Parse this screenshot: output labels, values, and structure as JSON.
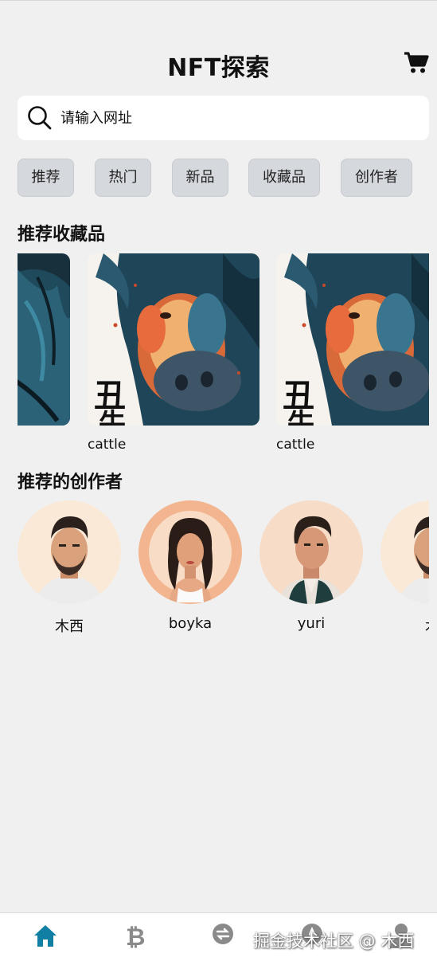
{
  "header": {
    "title": "NFT探索",
    "cart_icon": "shopping-cart-icon"
  },
  "search": {
    "placeholder": "请输入网址",
    "value": "",
    "icon": "search-icon"
  },
  "tabs": [
    {
      "label": "推荐"
    },
    {
      "label": "热门"
    },
    {
      "label": "新品"
    },
    {
      "label": "收藏品"
    },
    {
      "label": "创作者"
    }
  ],
  "collections": {
    "title": "推荐收藏品",
    "items": [
      {
        "name": ""
      },
      {
        "name": "cattle"
      },
      {
        "name": "cattle"
      }
    ]
  },
  "creators": {
    "title": "推荐的创作者",
    "items": [
      {
        "name": "木西"
      },
      {
        "name": "boyka"
      },
      {
        "name": "yuri"
      },
      {
        "name": "木"
      }
    ]
  },
  "nav": {
    "items": [
      {
        "icon": "home-icon",
        "active": true
      },
      {
        "icon": "bitcoin-icon",
        "active": false
      },
      {
        "icon": "exchange-icon",
        "active": false
      },
      {
        "icon": "compass-icon",
        "active": false
      },
      {
        "icon": "user-icon",
        "active": false
      }
    ],
    "active_color": "#117fa3",
    "inactive_color": "#8a8a8a"
  },
  "watermark": "掘金技术社区 @ 木西"
}
